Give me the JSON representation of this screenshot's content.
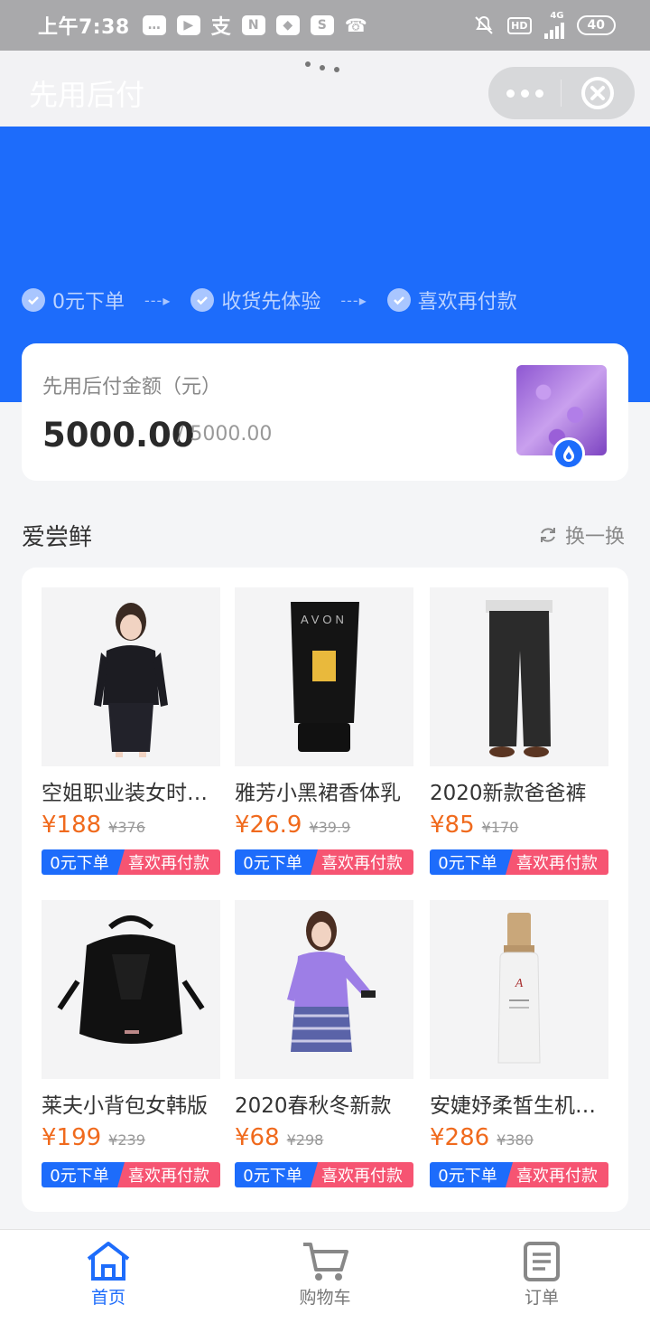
{
  "status_bar": {
    "time": "上午7:38",
    "network": "4G",
    "battery": "40",
    "hd": "HD"
  },
  "header": {
    "title": "先用后付"
  },
  "steps": [
    {
      "label": "0元下单"
    },
    {
      "label": "收货先体验"
    },
    {
      "label": "喜欢再付款"
    }
  ],
  "amount": {
    "label": "先用后付金额（元）",
    "value": "5000.00",
    "total": "/ 5000.00"
  },
  "section": {
    "title": "爱尝鲜",
    "refresh_label": "换一换"
  },
  "products": [
    {
      "name": "空姐职业装女时尚套装",
      "price": "¥188",
      "old_price": "¥376",
      "tag_a": "0元下单",
      "tag_b": "喜欢再付款"
    },
    {
      "name": "雅芳小黑裙香体乳",
      "price": "¥26.9",
      "old_price": "¥39.9",
      "tag_a": "0元下单",
      "tag_b": "喜欢再付款"
    },
    {
      "name": "2020新款爸爸裤",
      "price": "¥85",
      "old_price": "¥170",
      "tag_a": "0元下单",
      "tag_b": "喜欢再付款"
    },
    {
      "name": "莱夫小背包女韩版",
      "price": "¥199",
      "old_price": "¥239",
      "tag_a": "0元下单",
      "tag_b": "喜欢再付款"
    },
    {
      "name": "2020春秋冬新款",
      "price": "¥68",
      "old_price": "¥298",
      "tag_a": "0元下单",
      "tag_b": "喜欢再付款"
    },
    {
      "name": "安婕妤柔皙生机精华",
      "price": "¥286",
      "old_price": "¥380",
      "tag_a": "0元下单",
      "tag_b": "喜欢再付款"
    }
  ],
  "tabbar": [
    {
      "label": "首页"
    },
    {
      "label": "购物车"
    },
    {
      "label": "订单"
    }
  ],
  "colors": {
    "primary": "#1d6cfb",
    "accent_price": "#f06a1d",
    "tag_pink": "#f65472"
  }
}
